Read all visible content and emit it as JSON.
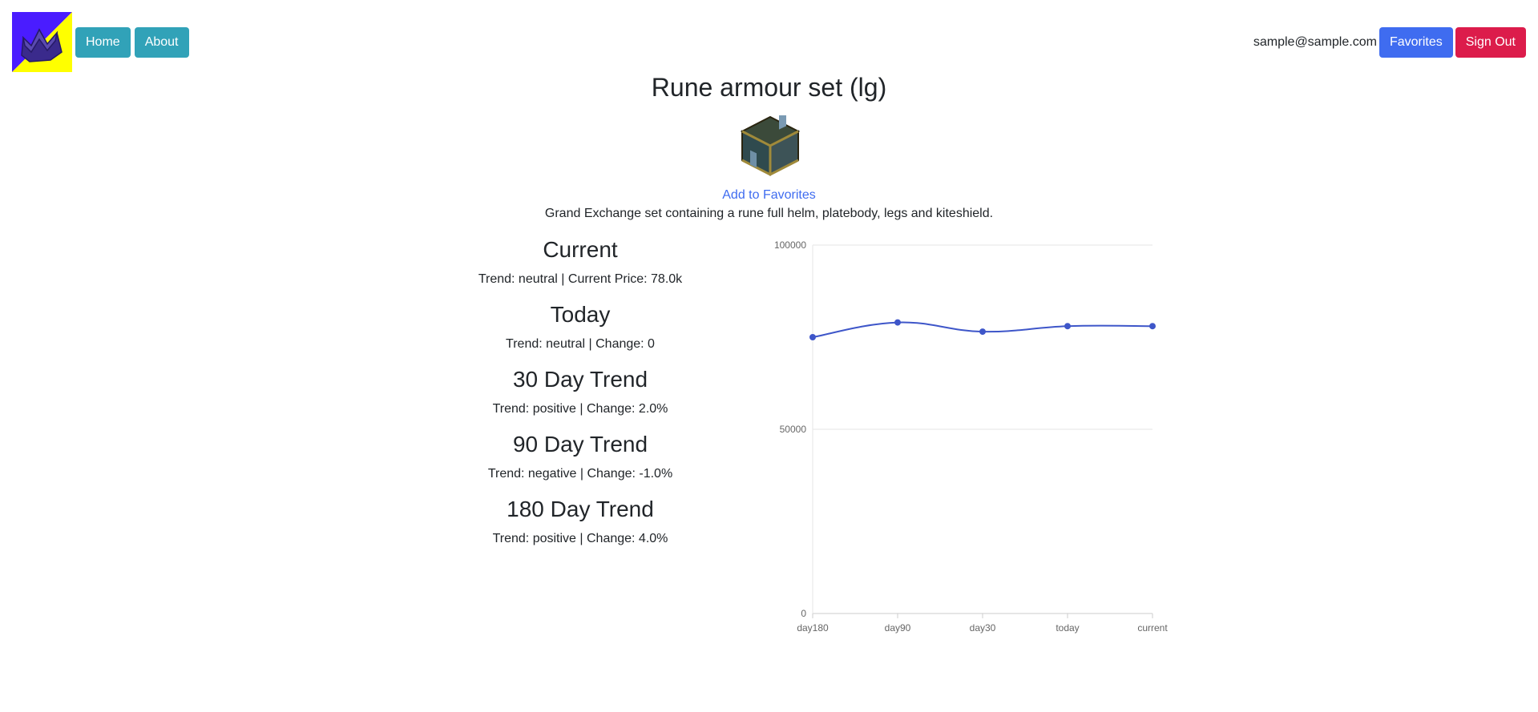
{
  "nav": {
    "home_label": "Home",
    "about_label": "About",
    "email": "sample@sample.com",
    "favorites_label": "Favorites",
    "signout_label": "Sign Out"
  },
  "item": {
    "title": "Rune armour set (lg)",
    "add_favorites_label": "Add to Favorites",
    "description": "Grand Exchange set containing a rune full helm, platebody, legs and kiteshield."
  },
  "stats": [
    {
      "heading": "Current",
      "text": "Trend: neutral | Current Price: 78.0k"
    },
    {
      "heading": "Today",
      "text": "Trend: neutral | Change: 0"
    },
    {
      "heading": "30 Day Trend",
      "text": "Trend: positive | Change: 2.0%"
    },
    {
      "heading": "90 Day Trend",
      "text": "Trend: negative | Change: -1.0%"
    },
    {
      "heading": "180 Day Trend",
      "text": "Trend: positive | Change: 4.0%"
    }
  ],
  "colors": {
    "accent_info": "#31a2b8",
    "accent_primary": "#3f6cf0",
    "accent_danger": "#dc1c4b",
    "series_line": "#3e56c9",
    "logo_yellow": "#ffff00",
    "logo_violet": "#4a1cff"
  },
  "chart_data": {
    "type": "line",
    "categories": [
      "day180",
      "day90",
      "day30",
      "today",
      "current"
    ],
    "series": [
      {
        "values": [
          75000,
          79000,
          76500,
          78000,
          78000
        ]
      }
    ],
    "ylim": [
      0,
      100000
    ],
    "yticks": [
      "0",
      "50000",
      "100000"
    ],
    "grid": true,
    "legend": "none"
  }
}
